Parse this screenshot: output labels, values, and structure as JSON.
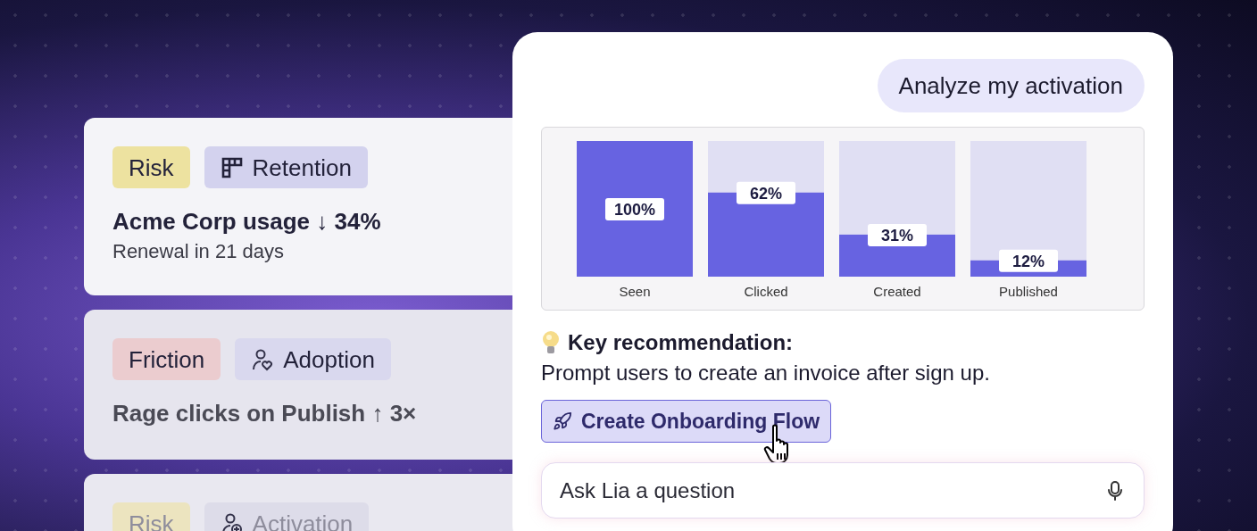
{
  "cards": [
    {
      "faded": false,
      "tags": [
        {
          "label": "Risk",
          "color": "#ede2a0"
        },
        {
          "label": "Retention",
          "color": "#d3d2ee"
        }
      ],
      "title": "Acme Corp usage ↓ 34%",
      "subtitle": "Renewal in 21 days"
    },
    {
      "faded": false,
      "tags": [
        {
          "label": "Friction",
          "color": "#ebcccf"
        },
        {
          "label": "Adoption",
          "color": "#d9d8ee"
        }
      ],
      "title": "Rage clicks on Publish ↑ 3×"
    },
    {
      "faded": true,
      "tags": [
        {
          "label": "Risk",
          "color": "#ece4bf"
        },
        {
          "label": "Activation",
          "color": "#dddce9"
        }
      ]
    }
  ],
  "chat": {
    "user_message": "Analyze my activation",
    "chart_data": {
      "type": "bar",
      "categories": [
        "Seen",
        "Clicked",
        "Created",
        "Published"
      ],
      "values": [
        100,
        62,
        31,
        12
      ],
      "ylim": [
        0,
        100
      ],
      "value_labels": [
        "100%",
        "62%",
        "31%",
        "12%"
      ]
    },
    "recommendation": {
      "heading": "Key recommendation:",
      "text": "Prompt users to create an invoice after sign up."
    },
    "action_button": "Create Onboarding Flow",
    "input": {
      "placeholder": "Ask Lia a question"
    }
  }
}
